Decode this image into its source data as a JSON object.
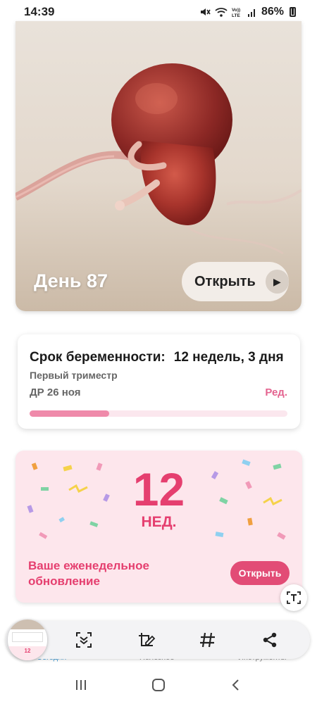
{
  "status_bar": {
    "time": "14:39",
    "battery": "86%",
    "icons": [
      "mute-icon",
      "wifi-icon",
      "volte-icon",
      "signal-icon",
      "battery-icon"
    ]
  },
  "hero": {
    "day_label": "День 87",
    "open_label": "Открыть",
    "play_icon": "play-icon"
  },
  "pregnancy": {
    "title_prefix": "Срок беременности:",
    "title_value": "12 недель, 3 дня",
    "trimester": "Первый триместр",
    "due_date": "ДР 26 ноя",
    "edit_label": "Ред.",
    "progress": 0.31
  },
  "weekly": {
    "week_number": "12",
    "week_unit": "НЕД.",
    "text": "Ваше еженедельное обновление",
    "open_label": "Открыть"
  },
  "bottom_tabs": [
    "Сегодня",
    "Полезное",
    "Инструменты"
  ],
  "toolbar": {
    "icons": [
      "scroll-capture-icon",
      "draw-crop-icon",
      "tag-icon",
      "share-icon"
    ],
    "thumbnail_number": "12"
  },
  "navbar": {
    "icons": [
      "recent-apps-icon",
      "home-icon",
      "back-icon"
    ]
  },
  "colors": {
    "accent_pink": "#e53f6f",
    "button_pink": "#e24c76",
    "progress_pink": "#ef8aaa",
    "card_pink_bg": "#fde6ec"
  }
}
